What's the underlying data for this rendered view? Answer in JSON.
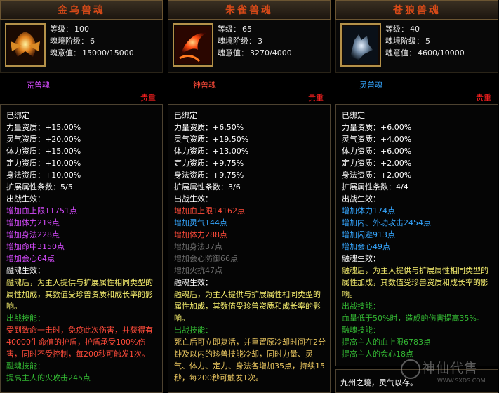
{
  "cards": [
    {
      "title": "金乌兽魂",
      "level_label": "等级：",
      "level": "100",
      "stage_label": "魂境阶级：",
      "stage": "6",
      "soul_label": "魂意值：",
      "soul": "15000/15000",
      "type": "荒兽魂",
      "quality": "贵重",
      "lines": [
        {
          "t": "已绑定",
          "c": "w"
        },
        {
          "t": "力量资质：+15.00%",
          "c": "w"
        },
        {
          "t": "灵气资质：+20.00%",
          "c": "w"
        },
        {
          "t": "体力资质：+15.00%",
          "c": "w"
        },
        {
          "t": "定力资质：+10.00%",
          "c": "w"
        },
        {
          "t": "身法资质：+10.00%",
          "c": "w"
        },
        {
          "t": "扩展属性条数：5/5",
          "c": "w"
        },
        {
          "t": "出战生效：",
          "c": "w"
        },
        {
          "t": "增加血上限11751点",
          "c": "pur"
        },
        {
          "t": "增加体力219点",
          "c": "pur"
        },
        {
          "t": "增加身法228点",
          "c": "pur"
        },
        {
          "t": "增加命中3150点",
          "c": "pur"
        },
        {
          "t": "增加会心64点",
          "c": "pur"
        },
        {
          "t": "融魂生效：",
          "c": "w"
        },
        {
          "t": "融魂后，为主人提供与扩展属性相同类型的属性加成，其数值受珍兽资质和成长率的影响。",
          "c": "yel"
        },
        {
          "t": "出战技能：",
          "c": "grn"
        },
        {
          "t": "受到致命一击时，免疫此次伤害，并获得有40000生命值的护盾，护盾承受100%伤害，同时不受控制，每200秒可触发1次。",
          "c": "red"
        },
        {
          "t": "融魂技能：",
          "c": "grn"
        },
        {
          "t": "提高主人的火攻击245点",
          "c": "grn"
        }
      ]
    },
    {
      "title": "朱雀兽魂",
      "level_label": "等级：",
      "level": "65",
      "stage_label": "魂境阶级：",
      "stage": "3",
      "soul_label": "魂意值：",
      "soul": "3270/4000",
      "type": "神兽魂",
      "quality": "贵重",
      "lines": [
        {
          "t": "已绑定",
          "c": "w"
        },
        {
          "t": "力量资质：+6.50%",
          "c": "w"
        },
        {
          "t": "灵气资质：+19.50%",
          "c": "w"
        },
        {
          "t": "体力资质：+13.00%",
          "c": "w"
        },
        {
          "t": "定力资质：+9.75%",
          "c": "w"
        },
        {
          "t": "身法资质：+9.75%",
          "c": "w"
        },
        {
          "t": "扩展属性条数：3/6",
          "c": "w"
        },
        {
          "t": "出战生效：",
          "c": "w"
        },
        {
          "t": "增加血上限14162点",
          "c": "red"
        },
        {
          "t": "增加灵气144点",
          "c": "blu"
        },
        {
          "t": "增加体力288点",
          "c": "red"
        },
        {
          "t": "增加身法37点",
          "c": "gry"
        },
        {
          "t": "增加会心防御66点",
          "c": "gry"
        },
        {
          "t": "增加火抗47点",
          "c": "gry"
        },
        {
          "t": "融魂生效：",
          "c": "w"
        },
        {
          "t": "融魂后，为主人提供与扩展属性相同类型的属性加成，其数值受珍兽资质和成长率的影响。",
          "c": "yel"
        },
        {
          "t": "出战技能：",
          "c": "grn"
        },
        {
          "t": "死亡后可立即复活，并重置原冷却时间在2分钟及以内的珍兽技能冷却，同时力量、灵气、体力、定力、身法各增加35点，持续15秒，每200秒可触发1次。",
          "c": "yel2"
        }
      ]
    },
    {
      "title": "苍狼兽魂",
      "level_label": "等级：",
      "level": "40",
      "stage_label": "魂境阶级：",
      "stage": "5",
      "soul_label": "魂意值：",
      "soul": "4600/10000",
      "type": "灵兽魂",
      "quality": "贵重",
      "lines": [
        {
          "t": "已绑定",
          "c": "w"
        },
        {
          "t": "力量资质：+6.00%",
          "c": "w"
        },
        {
          "t": "灵气资质：+4.00%",
          "c": "w"
        },
        {
          "t": "体力资质：+6.00%",
          "c": "w"
        },
        {
          "t": "定力资质：+2.00%",
          "c": "w"
        },
        {
          "t": "身法资质：+2.00%",
          "c": "w"
        },
        {
          "t": "扩展属性条数：4/4",
          "c": "w"
        },
        {
          "t": "出战生效：",
          "c": "w"
        },
        {
          "t": "增加体力174点",
          "c": "blu"
        },
        {
          "t": "增加内、外功攻击2454点",
          "c": "blu"
        },
        {
          "t": "增加闪避913点",
          "c": "blu"
        },
        {
          "t": "增加会心49点",
          "c": "blu"
        },
        {
          "t": "融魂生效：",
          "c": "w"
        },
        {
          "t": "融魂后，为主人提供与扩展属性相同类型的属性加成，其数值受珍兽资质和成长率的影响。",
          "c": "yel"
        },
        {
          "t": "出战技能：",
          "c": "grn"
        },
        {
          "t": "血量低于50%时，造成的伤害提高35%。",
          "c": "grn"
        },
        {
          "t": "融魂技能：",
          "c": "grn"
        },
        {
          "t": "提高主人的血上限6783点",
          "c": "grn"
        },
        {
          "t": "提高主人的会心18点",
          "c": "grn"
        }
      ]
    }
  ],
  "extra": {
    "text": "九州之境，灵气以存。"
  },
  "watermark": {
    "cn": "神仙代售",
    "url": "WWW.SXDS.COM"
  },
  "colors": {
    "title": "#d84a18",
    "quality": "#ff2020",
    "purple": "#d74bff",
    "blue": "#35a6ff"
  }
}
